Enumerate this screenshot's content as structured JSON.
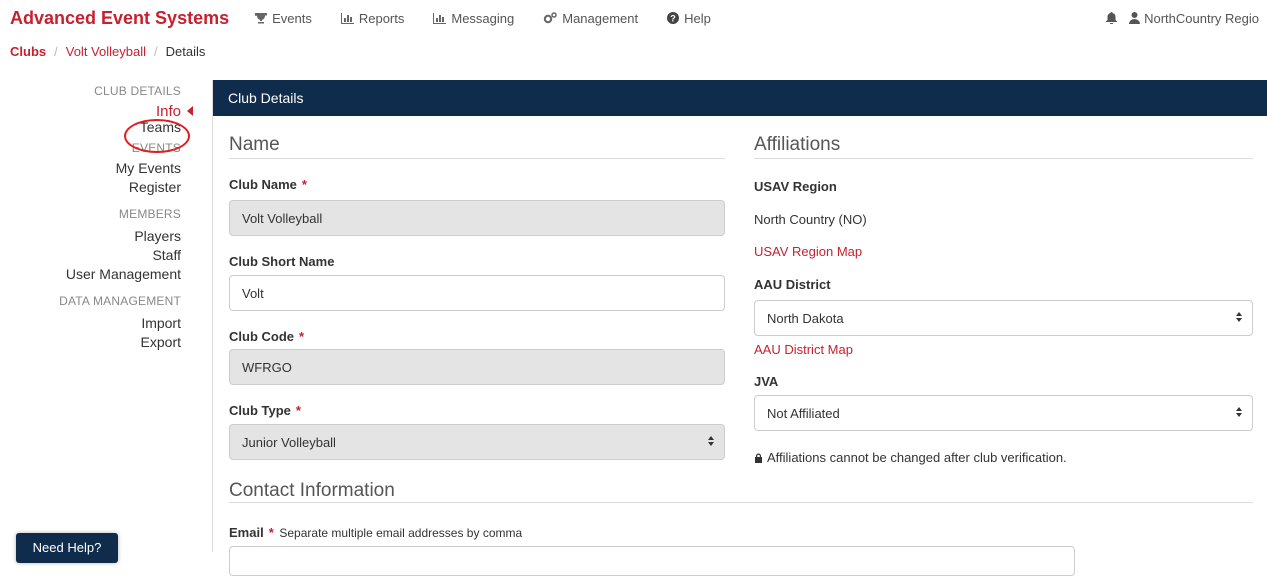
{
  "app": {
    "brand": "Advanced Event Systems"
  },
  "nav": {
    "items": [
      {
        "label": "Events",
        "icon": "trophy-icon"
      },
      {
        "label": "Reports",
        "icon": "bar-chart-icon"
      },
      {
        "label": "Messaging",
        "icon": "bar-chart-icon"
      },
      {
        "label": "Management",
        "icon": "gears-icon"
      },
      {
        "label": "Help",
        "icon": "question-circle-icon"
      }
    ],
    "user": "NorthCountry Regio"
  },
  "breadcrumb": {
    "root": "Clubs",
    "club": "Volt Volleyball",
    "current": "Details"
  },
  "sidebar": {
    "club_details": "CLUB DETAILS",
    "info": "Info",
    "teams": "Teams",
    "events": "EVENTS",
    "my_events": "My Events",
    "register": "Register",
    "members": "MEMBERS",
    "players": "Players",
    "staff": "Staff",
    "user_management": "User Management",
    "data_management": "DATA MANAGEMENT",
    "import": "Import",
    "export": "Export"
  },
  "panel": {
    "title": "Club Details"
  },
  "name_section": {
    "heading": "Name",
    "club_name_label": "Club Name",
    "club_name_value": "Volt Volleyball",
    "short_name_label": "Club Short Name",
    "short_name_value": "Volt",
    "code_label": "Club Code",
    "code_value": "WFRGO",
    "type_label": "Club Type",
    "type_value": "Junior Volleyball",
    "required_mark": "*"
  },
  "affiliations": {
    "heading": "Affiliations",
    "usav_label": "USAV Region",
    "usav_value": "North Country (NO)",
    "usav_map_link": "USAV Region Map",
    "aau_label": "AAU District",
    "aau_value": "North Dakota",
    "aau_map_link": "AAU District Map",
    "jva_label": "JVA",
    "jva_value": "Not Affiliated",
    "note": "Affiliations cannot be changed after club verification."
  },
  "contact": {
    "heading": "Contact Information",
    "email_label": "Email",
    "email_hint": "Separate multiple email addresses by comma"
  },
  "help_button": "Need Help?",
  "colors": {
    "brand_red": "#c8202f",
    "header_navy": "#0f2c4c",
    "readonly_gray": "#e4e4e4",
    "annotation_red": "#e31d1d"
  }
}
